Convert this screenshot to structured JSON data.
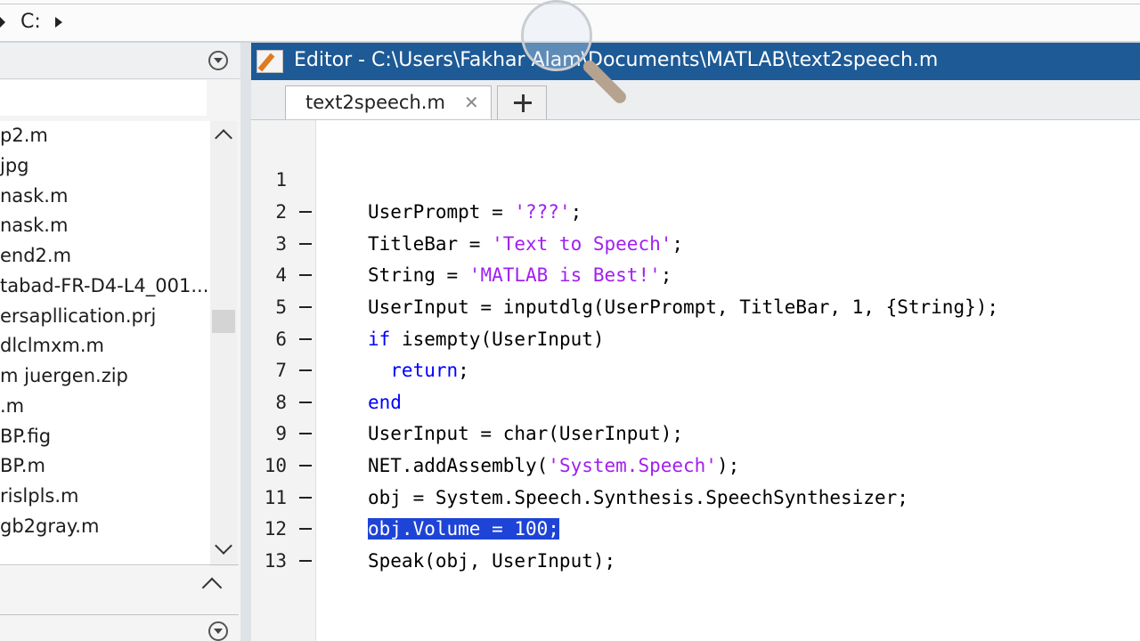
{
  "address_bar": {
    "path": "C:"
  },
  "files": [
    "p2.m",
    "jpg",
    "nask.m",
    "nask.m",
    "end2.m",
    "tabad-FR-D4-L4_001...",
    "ersapllication.prj",
    "dlclmxm.m",
    "m juergen.zip",
    ".m",
    "BP.fig",
    "BP.m",
    "rislpls.m",
    "gb2gray.m"
  ],
  "editor": {
    "title": "Editor - C:\\Users\\Fakhar Alam\\Documents\\MATLAB\\text2speech.m",
    "tab_label": "text2speech.m",
    "tab_close": "✕",
    "line_numbers": [
      "1",
      "2",
      "3",
      "4",
      "5",
      "6",
      "7",
      "8",
      "9",
      "10",
      "11",
      "12",
      "13"
    ],
    "code": {
      "l2a": "UserPrompt = ",
      "l2b": "'???'",
      "l2c": ";",
      "l3a": "TitleBar = ",
      "l3b": "'Text to Speech'",
      "l3c": ";",
      "l4a": "String = ",
      "l4b": "'MATLAB is Best!'",
      "l4c": ";",
      "l5": "UserInput = inputdlg(UserPrompt, TitleBar, 1, {String});",
      "l6a": "if",
      "l6b": " isempty(UserInput)",
      "l7a": "  return",
      "l7b": ";",
      "l8": "end",
      "l9": "UserInput = char(UserInput);",
      "l10a": "NET.addAssembly(",
      "l10b": "'System.Speech'",
      "l10c": ");",
      "l11": "obj = System.Speech.Synthesis.SpeechSynthesizer;",
      "l12": "obj.Volume = 100;",
      "l13": "Speak(obj, UserInput);"
    }
  }
}
